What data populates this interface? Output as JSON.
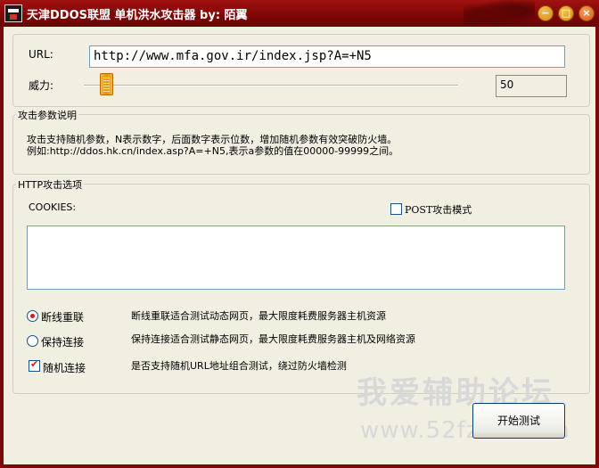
{
  "window": {
    "title": "天津DDOS联盟 单机洪水攻击器 by: 陌翼",
    "minimize_glyph": "−",
    "maximize_glyph": "□",
    "close_glyph": "×"
  },
  "target": {
    "url_label": "URL:",
    "url_value": "http://www.mfa.gov.ir/index.jsp?A=+N5",
    "power_label": "威力:",
    "power_value": "50"
  },
  "params_group": {
    "title": "攻击参数说明",
    "line1": "攻击支持随机参数，N表示数字，后面数字表示位数，增加随机参数有效突破防火墙。",
    "line2": "例如:http://ddos.hk.cn/index.asp?A=+N5,表示a参数的值在00000-99999之间。"
  },
  "http_group": {
    "title": "HTTP攻击选项",
    "cookies_label": "COOKIES:",
    "cookies_value": "",
    "post_mode_label": "POST攻击模式",
    "post_mode_checked": false
  },
  "modes": [
    {
      "label": "断线重联",
      "description": "断线重联适合测试动态网页，最大限度耗费服务器主机资源",
      "type": "radio",
      "checked": true
    },
    {
      "label": "保持连接",
      "description": "保持连接适合测试静态网页，最大限度耗费服务器主机及网络资源",
      "type": "radio",
      "checked": false
    },
    {
      "label": "随机连接",
      "description": "是否支持随机URL地址组合测试，绕过防火墙检测",
      "type": "checkbox",
      "checked": true
    }
  ],
  "start_button": "开始测试",
  "watermark": {
    "text": "我爱辅助论坛",
    "url": "www.52fzba.com"
  },
  "colors": {
    "titlebar": "#8b0a0a",
    "window_bg": "#f1efe2",
    "check_mark": "#d41a1a",
    "slider_thumb": "#e8920a"
  }
}
